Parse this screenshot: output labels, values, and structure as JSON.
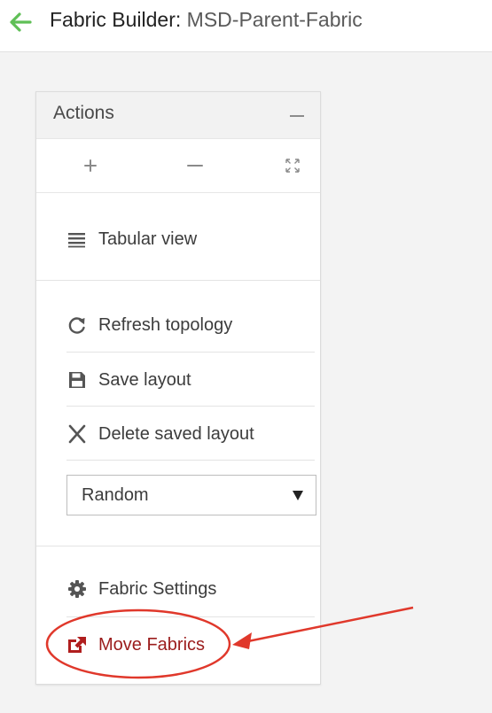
{
  "header": {
    "title_prefix": "Fabric Builder:",
    "title_name": "MSD-Parent-Fabric"
  },
  "actions_panel": {
    "title": "Actions",
    "view_items": [
      {
        "label": "Tabular view",
        "icon": "list-icon"
      }
    ],
    "layout_items": [
      {
        "label": "Refresh topology",
        "icon": "refresh-icon"
      },
      {
        "label": "Save layout",
        "icon": "floppy-disk-icon"
      },
      {
        "label": "Delete saved layout",
        "icon": "x-icon"
      }
    ],
    "layout_select": {
      "value": "Random"
    },
    "fabric_items": [
      {
        "label": "Fabric Settings",
        "icon": "gear-icon"
      },
      {
        "label": "Move Fabrics",
        "icon": "external-link-icon"
      }
    ]
  },
  "colors": {
    "accent_green": "#5fbf56",
    "move_fabrics": "#9b1c1c",
    "annotation_red": "#e0382b"
  }
}
